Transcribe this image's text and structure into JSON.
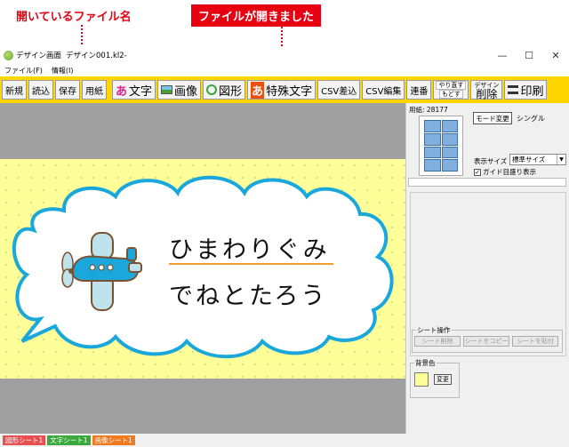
{
  "annotations": {
    "open_file_label": "開いているファイル名",
    "file_opened_label": "ファイルが開きました"
  },
  "window": {
    "title": "デザイン画面",
    "file_name": "デザイン001.kl2-",
    "minimize": "—",
    "maximize": "☐",
    "close": "✕"
  },
  "menu": {
    "items": [
      {
        "label": "ファイル(F)"
      },
      {
        "label": "情報(I)"
      }
    ]
  },
  "toolbar": {
    "new": "新規",
    "open": "読込",
    "save": "保存",
    "paper": "用紙",
    "text_icon": "あ",
    "text": "文字",
    "image": "画像",
    "shape": "図形",
    "special_icon": "あ",
    "special_text": "特殊文字",
    "csv_insert": "CSV差込",
    "csv_edit": "CSV編集",
    "serial": "連番",
    "redo": "やり直す",
    "undo": "もどす",
    "design_small": "デザイン",
    "delete": "削除",
    "print": "印刷"
  },
  "canvas": {
    "line1": "ひまわりぐみ",
    "line2": "でねとたろう",
    "sheet_color": "#ffff99",
    "cloud_border_color": "#1aa7dc",
    "underline_color": "#f0a030"
  },
  "right_panel": {
    "paper_label": "用紙: 28177",
    "mode_button": "モード変更",
    "mode_value": "シングル",
    "display_size_label": "表示サイズ",
    "display_size_value": "標準サイズ",
    "guide_check": "✓",
    "guide_label": "ガイド目盛り表示",
    "sheet_ops_label": "シート操作",
    "sheet_delete": "シート削除",
    "sheet_copy": "シートをコピー",
    "sheet_add": "シートを貼付",
    "bg_color_label": "背景色",
    "bg_change": "変更"
  },
  "tabs": [
    {
      "label": "図形シート1",
      "color": "#e85050"
    },
    {
      "label": "文字シート1",
      "color": "#3aa83a"
    },
    {
      "label": "画像シート1",
      "color": "#f07a20"
    }
  ]
}
